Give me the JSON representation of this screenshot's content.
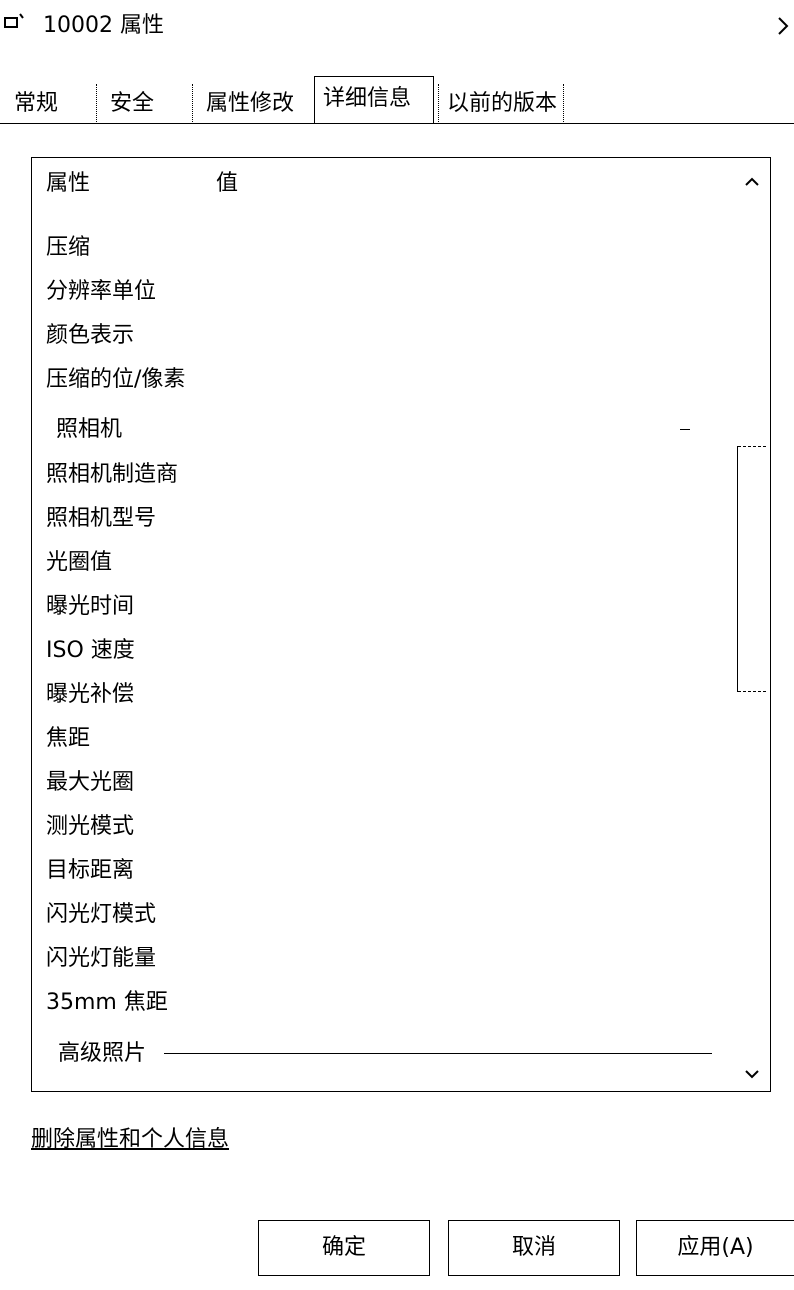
{
  "window": {
    "title": "10002 属性"
  },
  "tabs": [
    "常规",
    "安全",
    "属性修改",
    "详细信息",
    "以前的版本"
  ],
  "list": {
    "header": {
      "col1": "属性",
      "col2": "值"
    },
    "image_rows": [
      "压缩",
      "分辨率单位",
      "颜色表示",
      "压缩的位/像素"
    ],
    "camera_group": "照相机",
    "camera_rows": [
      "照相机制造商",
      "照相机型号",
      "光圈值",
      "曝光时间",
      "ISO 速度",
      "曝光补偿",
      "焦距",
      "最大光圈",
      "测光模式",
      "目标距离",
      "闪光灯模式",
      "闪光灯能量",
      "35mm 焦距"
    ],
    "advanced_group": "高级照片"
  },
  "links": {
    "remove_props": "删除属性和个人信息"
  },
  "buttons": {
    "ok": "确定",
    "cancel": "取消",
    "apply": "应用(A)"
  }
}
